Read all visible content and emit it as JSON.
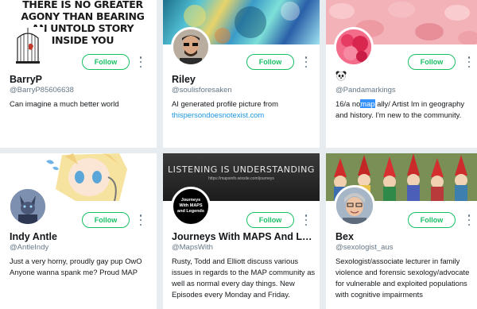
{
  "cards": [
    {
      "banner_text": "THERE IS NO GREATER AGONY THAN BEARING AN UNTOLD STORY INSIDE YOU",
      "follow_label": "Follow",
      "name": "BarryP",
      "handle": "@BarryP85606638",
      "bio": "Can imagine a much better world"
    },
    {
      "follow_label": "Follow",
      "name": "Riley",
      "handle": "@soulisforesaken",
      "bio": "AI generated profile picture from",
      "bio_link": "thispersondoesnotexist.com"
    },
    {
      "follow_label": "Follow",
      "name": "",
      "handle": "@Pandamarkings",
      "bio_pre": "16/a no",
      "bio_selected": "map",
      "bio_post": " ally/ Artist Im in geography and history. I'm new to the community."
    },
    {
      "follow_label": "Follow",
      "name": "Indy Antle",
      "handle": "@AntleIndy",
      "bio": "Just a very horny, proudly gay pup OwO Anyone wanna spank me? Proud MAP"
    },
    {
      "banner_text": "LISTENING IS UNDERSTANDING",
      "banner_subtext": "https://mapsinfo.wixsite.com/journeys",
      "avatar_text": "Journeys With MAPS and Legends",
      "follow_label": "Follow",
      "name": "Journeys With MAPS And Le...",
      "handle": "@MapsWith",
      "bio": "Rusty, Todd and Elliott discuss various issues in regards to the MAP community as well as normal every day things. New Episodes every Monday and Friday."
    },
    {
      "follow_label": "Follow",
      "name": "Bex",
      "handle": "@sexologist_aus",
      "bio": "Sexologist/associate lecturer in family violence and forensic sexology/advocate for vulnerable and exploited populations with cognitive impairments"
    }
  ],
  "colors": {
    "follow_green": "#17bf63",
    "link_blue": "#1b95e0",
    "selection": "#3390ff"
  }
}
